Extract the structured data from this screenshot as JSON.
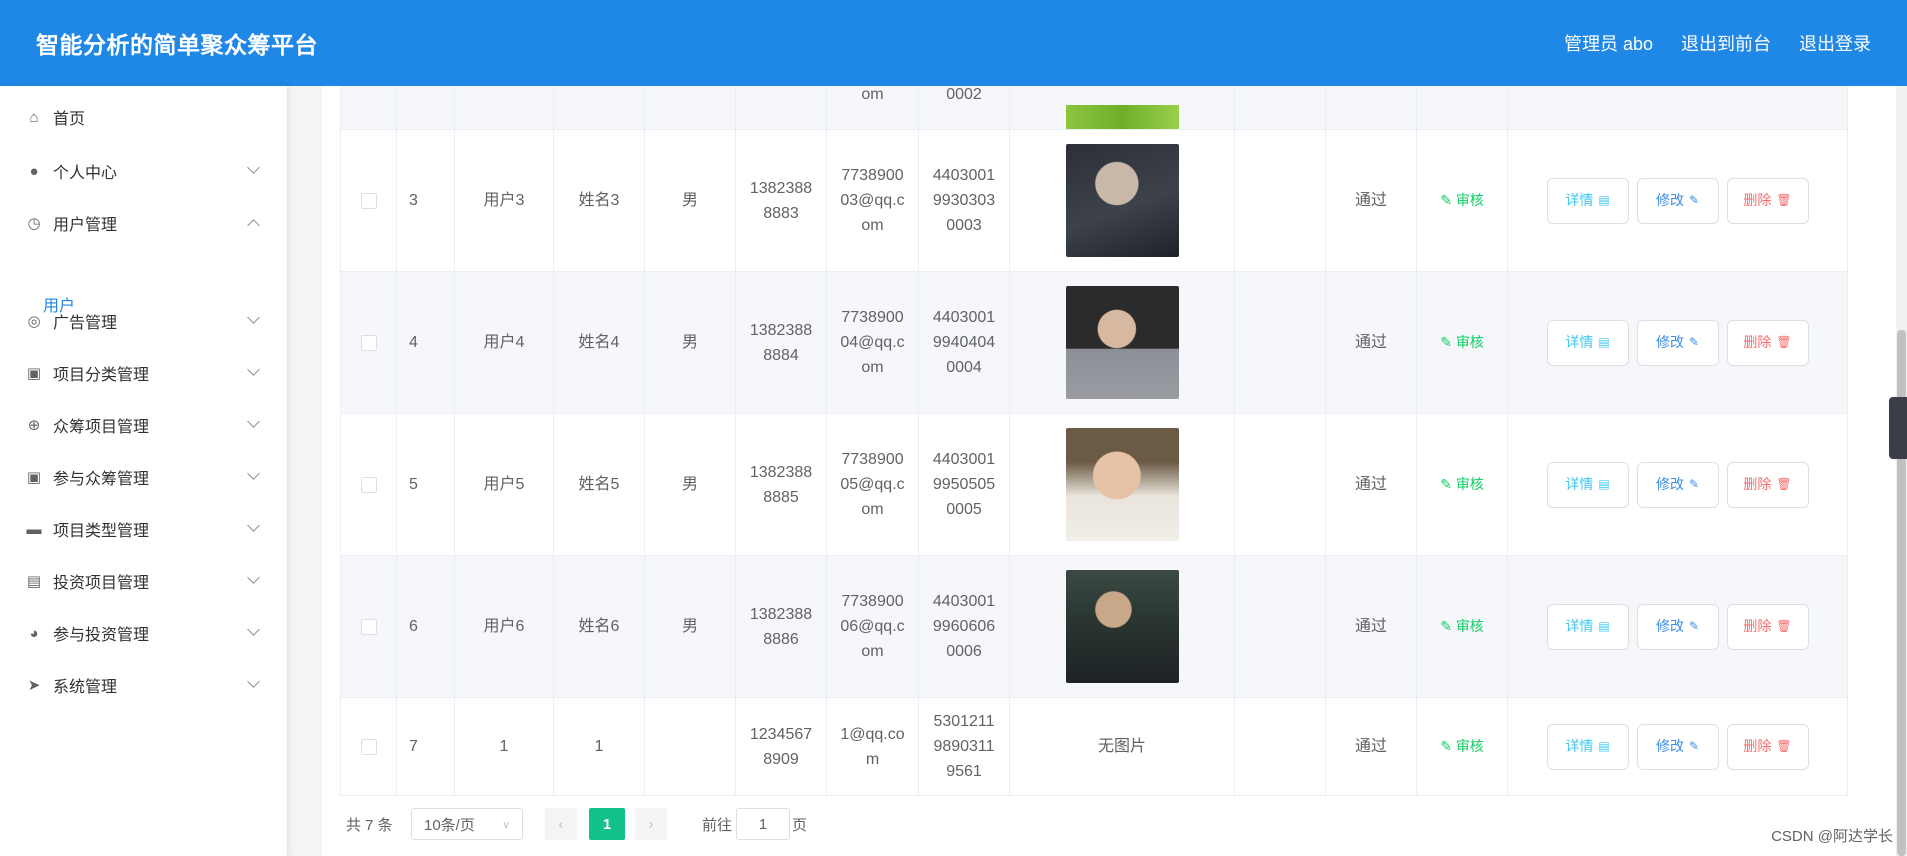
{
  "app": {
    "title": "智能分析的简单聚众筹平台",
    "header_links": [
      "管理员 abo",
      "退出到前台",
      "退出登录"
    ]
  },
  "sidebar": {
    "items": [
      {
        "label": "首页",
        "icon": "home-icon",
        "arrow": "none"
      },
      {
        "label": "个人中心",
        "icon": "user-icon",
        "arrow": "down"
      },
      {
        "label": "用户管理",
        "icon": "clock-icon",
        "arrow": "up"
      },
      {
        "label": "广告管理",
        "icon": "lifebuoy-icon",
        "arrow": "down"
      },
      {
        "label": "项目分类管理",
        "icon": "briefcase-icon",
        "arrow": "down"
      },
      {
        "label": "众筹项目管理",
        "icon": "compass-icon",
        "arrow": "down"
      },
      {
        "label": "参与众筹管理",
        "icon": "chat-icon",
        "arrow": "down"
      },
      {
        "label": "项目类型管理",
        "icon": "layers-icon",
        "arrow": "down"
      },
      {
        "label": "投资项目管理",
        "icon": "clipboard-icon",
        "arrow": "down"
      },
      {
        "label": "参与投资管理",
        "icon": "gauge-icon",
        "arrow": "down"
      },
      {
        "label": "系统管理",
        "icon": "paper-plane-icon",
        "arrow": "down"
      }
    ],
    "submenu_active": "用户"
  },
  "table": {
    "partial_row": {
      "email_tail": "om",
      "id_tail": "0002"
    },
    "rows": [
      {
        "index": "3",
        "account": "用户3",
        "name": "姓名3",
        "gender": "男",
        "phone": "13823888883",
        "email": "773890003@qq.com",
        "idcard": "440300199303030003",
        "photo": "photo-3",
        "status": "通过"
      },
      {
        "index": "4",
        "account": "用户4",
        "name": "姓名4",
        "gender": "男",
        "phone": "13823888884",
        "email": "773890004@qq.com",
        "idcard": "440300199404040004",
        "photo": "photo-4",
        "status": "通过"
      },
      {
        "index": "5",
        "account": "用户5",
        "name": "姓名5",
        "gender": "男",
        "phone": "13823888885",
        "email": "773890005@qq.com",
        "idcard": "440300199505050005",
        "photo": "photo-5",
        "status": "通过"
      },
      {
        "index": "6",
        "account": "用户6",
        "name": "姓名6",
        "gender": "男",
        "phone": "13823888886",
        "email": "773890006@qq.com",
        "idcard": "440300199606060006",
        "photo": "photo-6",
        "status": "通过"
      },
      {
        "index": "7",
        "account": "1",
        "name": "1",
        "gender": "",
        "phone": "12345678909",
        "email": "1@qq.com",
        "idcard": "530121198903119561",
        "photo": "",
        "no_photo_text": "无图片",
        "status": "通过"
      }
    ],
    "phone_lines": [
      [
        "1382388",
        "8883"
      ],
      [
        "1382388",
        "8884"
      ],
      [
        "1382388",
        "8885"
      ],
      [
        "1382388",
        "8886"
      ],
      [
        "1234567",
        "8909"
      ]
    ],
    "email_lines": [
      [
        "7738900",
        "03@qq.c",
        "om"
      ],
      [
        "7738900",
        "04@qq.c",
        "om"
      ],
      [
        "7738900",
        "05@qq.c",
        "om"
      ],
      [
        "7738900",
        "06@qq.c",
        "om"
      ],
      [
        "1@qq.co",
        "m"
      ]
    ],
    "idcard_lines": [
      [
        "4403001",
        "9930303",
        "0003"
      ],
      [
        "4403001",
        "9940404",
        "0004"
      ],
      [
        "4403001",
        "9950505",
        "0005"
      ],
      [
        "4403001",
        "9960606",
        "0006"
      ],
      [
        "5301211",
        "9890311",
        "9561"
      ]
    ],
    "audit_label": "审核",
    "actions": {
      "detail": "详情",
      "edit": "修改",
      "delete": "删除"
    }
  },
  "pagination": {
    "total": "共 7 条",
    "page_size": "10条/页",
    "current_page": "1",
    "goto_prefix": "前往",
    "goto_value": "1",
    "goto_suffix": "页"
  },
  "watermark": "CSDN @阿达学长",
  "colors": {
    "header": "#1f87e6",
    "active": "#13c28a",
    "detail": "#3ec7f2",
    "edit": "#3a8ee6",
    "delete": "#f56c6c",
    "audit": "#13ce66"
  }
}
